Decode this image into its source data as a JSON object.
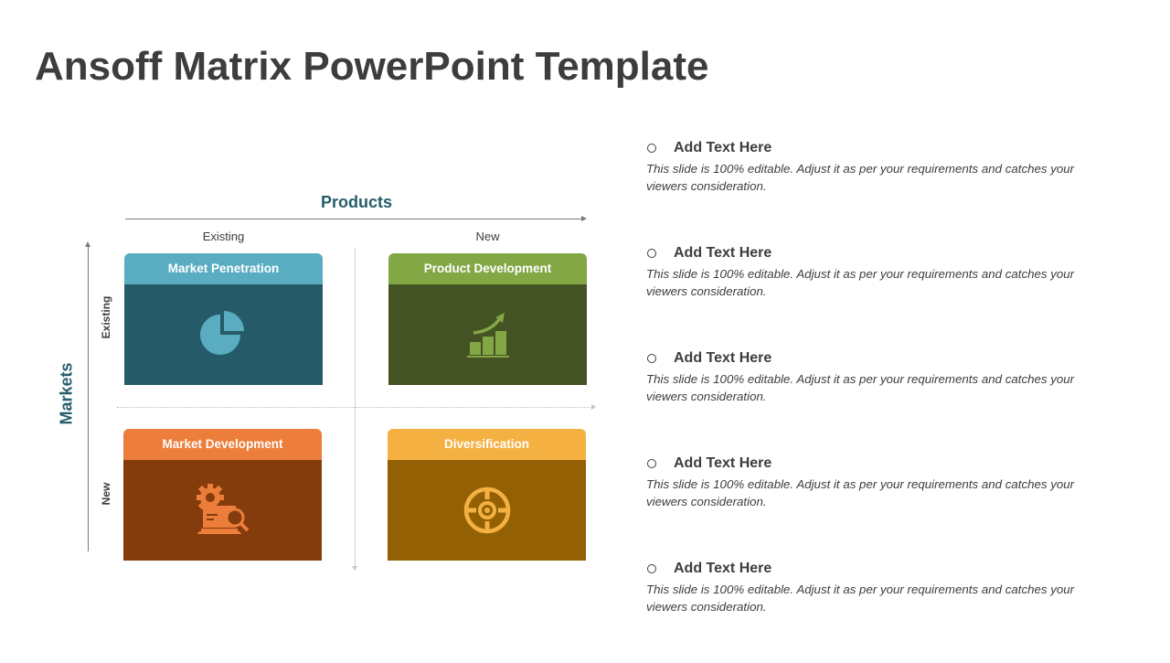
{
  "title": "Ansoff Matrix PowerPoint Template",
  "matrix": {
    "x_axis_label": "Products",
    "y_axis_label": "Markets",
    "columns": [
      "Existing",
      "New"
    ],
    "rows": [
      "Existing",
      "New"
    ],
    "quadrants": [
      {
        "label": "Market Penetration",
        "icon": "pie-chart-icon",
        "header_color": "#5aacc1",
        "body_color": "#255b68"
      },
      {
        "label": "Product Development",
        "icon": "growth-chart-icon",
        "header_color": "#84a746",
        "body_color": "#435323"
      },
      {
        "label": "Market Development",
        "icon": "gear-laptop-search-icon",
        "header_color": "#ed7d3a",
        "body_color": "#843c0c"
      },
      {
        "label": "Diversification",
        "icon": "target-icon",
        "header_color": "#f4b142",
        "body_color": "#936104"
      }
    ]
  },
  "bullets": [
    {
      "title": "Add Text Here",
      "text": "This slide is 100% editable. Adjust it as per your requirements and catches your viewers consideration."
    },
    {
      "title": "Add Text Here",
      "text": "This slide is 100% editable. Adjust it as per your requirements and catches your viewers consideration."
    },
    {
      "title": "Add Text Here",
      "text": "This slide is 100% editable. Adjust it as per your requirements and catches your viewers consideration."
    },
    {
      "title": "Add Text Here",
      "text": "This slide is 100% editable. Adjust it as per your requirements and catches your viewers consideration."
    },
    {
      "title": "Add Text Here",
      "text": "This slide is 100% editable. Adjust it as per your requirements and catches your viewers consideration."
    }
  ]
}
